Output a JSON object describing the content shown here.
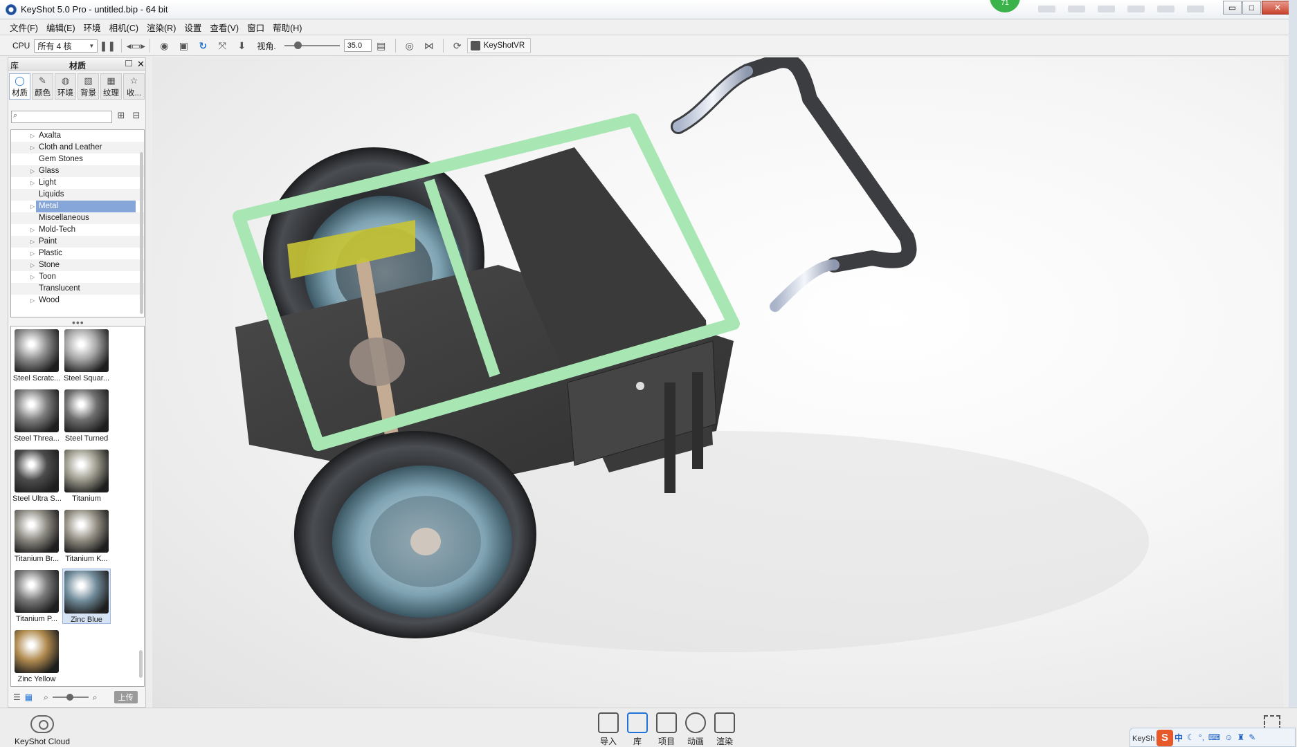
{
  "window": {
    "title": "KeyShot 5.0 Pro  - untitled.bip  - 64 bit",
    "badge": "71",
    "controls": {
      "minimize": "▭",
      "maximize": "□",
      "close": "✕"
    }
  },
  "menu": [
    "文件(F)",
    "编辑(E)",
    "环境",
    "相机(C)",
    "渲染(R)",
    "设置",
    "查看(V)",
    "窗口",
    "帮助(H)"
  ],
  "toolbar": {
    "cpu_label": "CPU",
    "cpu_select": "所有 4 核",
    "fov_label": "视角.",
    "fov_value": "35.0",
    "vr_label": "KeyShotVR"
  },
  "library": {
    "header_left": "库",
    "header_center": "材质",
    "tabs": [
      {
        "label": "材质",
        "icon": "material-icon",
        "glyph": "◯"
      },
      {
        "label": "颜色",
        "icon": "color-icon",
        "glyph": "✎"
      },
      {
        "label": "环境",
        "icon": "environment-icon",
        "glyph": "◍"
      },
      {
        "label": "背景",
        "icon": "background-icon",
        "glyph": "▧"
      },
      {
        "label": "纹理",
        "icon": "texture-icon",
        "glyph": "▦"
      },
      {
        "label": "收...",
        "icon": "favorites-icon",
        "glyph": "☆"
      }
    ],
    "search_placeholder": "",
    "categories": [
      {
        "label": "Axalta",
        "expandable": true
      },
      {
        "label": "Cloth and Leather",
        "expandable": true
      },
      {
        "label": "Gem Stones",
        "expandable": false
      },
      {
        "label": "Glass",
        "expandable": true
      },
      {
        "label": "Light",
        "expandable": true
      },
      {
        "label": "Liquids",
        "expandable": false
      },
      {
        "label": "Metal",
        "expandable": true,
        "selected": true
      },
      {
        "label": "Miscellaneous",
        "expandable": false
      },
      {
        "label": "Mold-Tech",
        "expandable": true
      },
      {
        "label": "Paint",
        "expandable": true
      },
      {
        "label": "Plastic",
        "expandable": true
      },
      {
        "label": "Stone",
        "expandable": true
      },
      {
        "label": "Toon",
        "expandable": true
      },
      {
        "label": "Translucent",
        "expandable": false
      },
      {
        "label": "Wood",
        "expandable": true
      }
    ],
    "materials": [
      {
        "label": "Steel Scratc...",
        "color": "#8d8d8d"
      },
      {
        "label": "Steel Squar...",
        "color": "#a4a4a4"
      },
      {
        "label": "Steel Threa...",
        "color": "#7f7f7f"
      },
      {
        "label": "Steel Turned",
        "color": "#6f6f6f"
      },
      {
        "label": "Steel Ultra S...",
        "color": "#4c4c4c"
      },
      {
        "label": "Titanium",
        "color": "#9c9a8c"
      },
      {
        "label": "Titanium Br...",
        "color": "#8e8b83"
      },
      {
        "label": "Titanium K...",
        "color": "#948f84"
      },
      {
        "label": "Titanium P...",
        "color": "#7b7b7b"
      },
      {
        "label": "Zinc Blue",
        "color": "#6f8a99",
        "selected": true
      },
      {
        "label": "Zinc Yellow",
        "color": "#b08a4e"
      }
    ],
    "upload_label": "上传"
  },
  "bottom": {
    "cloud_label": "KeyShot Cloud",
    "buttons": [
      {
        "label": "导入",
        "icon": "import-icon"
      },
      {
        "label": "库",
        "icon": "library-icon",
        "active": true
      },
      {
        "label": "项目",
        "icon": "project-icon"
      },
      {
        "label": "动画",
        "icon": "animation-icon"
      },
      {
        "label": "渲染",
        "icon": "render-icon"
      }
    ]
  },
  "ime": {
    "logo": "S",
    "mode": "中",
    "tab_text": "KeySh"
  },
  "colors": {
    "accent": "#1f73d6",
    "selection": "#86a5d9",
    "frame_green": "#a8e6b3",
    "body_dark": "#3b3b3b"
  }
}
